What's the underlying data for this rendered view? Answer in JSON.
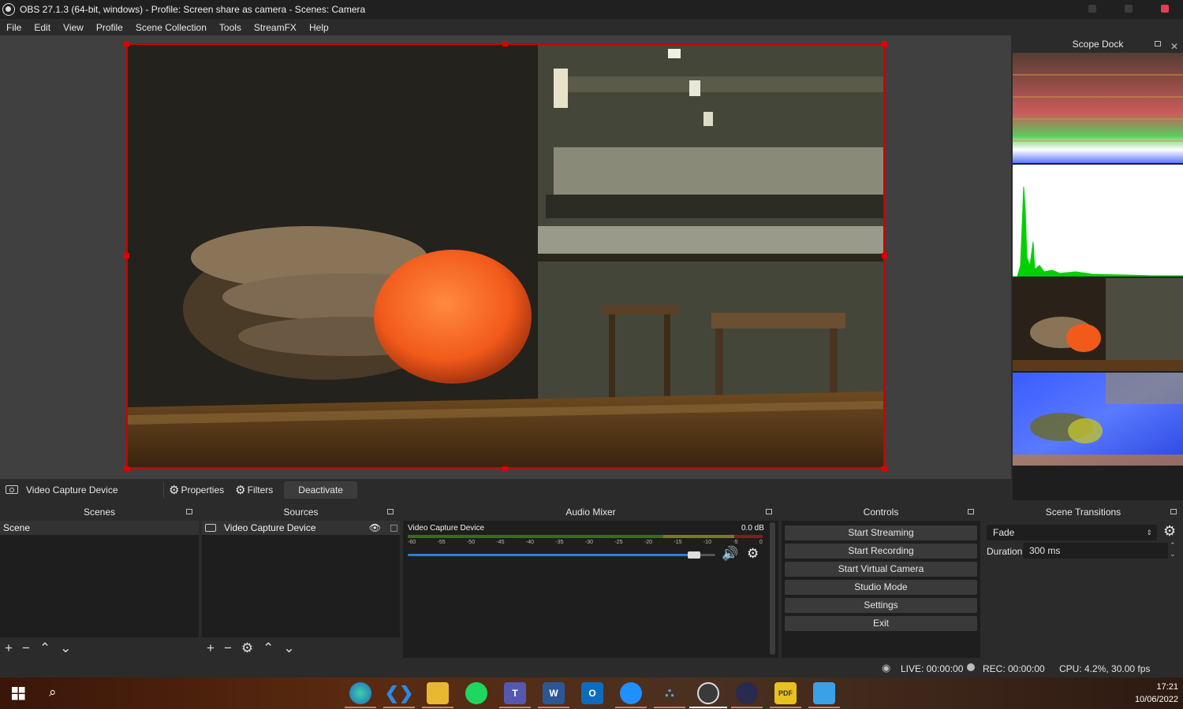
{
  "window": {
    "title": "OBS 27.1.3 (64-bit, windows) - Profile: Screen share as camera - Scenes: Camera"
  },
  "menu": [
    "File",
    "Edit",
    "View",
    "Profile",
    "Scene Collection",
    "Tools",
    "StreamFX",
    "Help"
  ],
  "scope_dock": {
    "title": "Scope Dock"
  },
  "source_toolbar": {
    "source_name": "Video Capture Device",
    "properties": "Properties",
    "filters": "Filters",
    "deactivate": "Deactivate"
  },
  "scenes": {
    "title": "Scenes",
    "items": [
      "Scene"
    ]
  },
  "sources": {
    "title": "Sources",
    "items": [
      "Video Capture Device"
    ]
  },
  "mixer": {
    "title": "Audio Mixer",
    "channel": "Video Capture Device",
    "level": "0.0 dB",
    "scale": [
      "-60",
      "-55",
      "-50",
      "-45",
      "-40",
      "-35",
      "-30",
      "-25",
      "-20",
      "-15",
      "-10",
      "-5",
      "0"
    ],
    "volume_fraction": 0.93
  },
  "controls": {
    "title": "Controls",
    "buttons": [
      "Start Streaming",
      "Start Recording",
      "Start Virtual Camera",
      "Studio Mode",
      "Settings",
      "Exit"
    ]
  },
  "transitions": {
    "title": "Scene Transitions",
    "selected": "Fade",
    "duration_label": "Duration",
    "duration_value": "300 ms"
  },
  "status": {
    "live": "LIVE: 00:00:00",
    "rec": "REC: 00:00:00",
    "cpu": "CPU: 4.2%, 30.00 fps"
  },
  "taskbar": {
    "time": "17:21",
    "date": "10/06/2022"
  },
  "colors": {
    "accent_red": "#d00000",
    "volume_blue": "#2d7fd3"
  }
}
